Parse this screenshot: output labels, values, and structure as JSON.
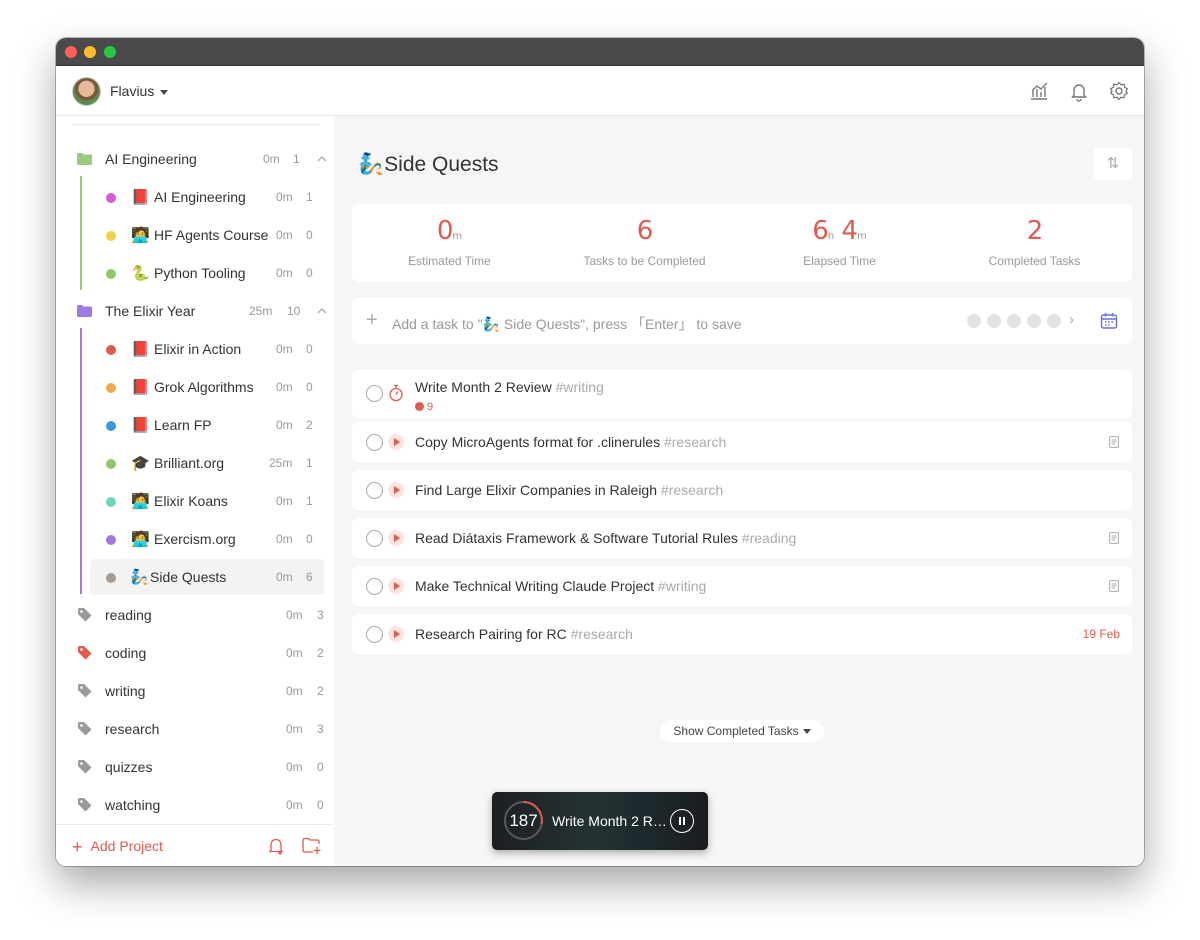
{
  "user": {
    "name": "Flavius"
  },
  "sidebar": {
    "groups": [
      {
        "label": "AI Engineering",
        "time": "0m",
        "count": "1",
        "color": "#9cc97a",
        "children": [
          {
            "emoji": "📕",
            "label": "AI Engineering",
            "time": "0m",
            "count": "1",
            "color": "#d55bd0"
          },
          {
            "emoji": "🧑‍💻",
            "label": "HF Agents Course",
            "time": "0m",
            "count": "0",
            "color": "#f0cf4a"
          },
          {
            "emoji": "🐍",
            "label": "Python Tooling",
            "time": "0m",
            "count": "0",
            "color": "#8fc76a"
          }
        ]
      },
      {
        "label": "The Elixir Year",
        "time": "25m",
        "count": "10",
        "color": "#a07ae0",
        "children": [
          {
            "emoji": "📕",
            "label": "Elixir in Action",
            "time": "0m",
            "count": "0",
            "color": "#e05a4e"
          },
          {
            "emoji": "📕",
            "label": "Grok Algorithms",
            "time": "0m",
            "count": "0",
            "color": "#f0a94a"
          },
          {
            "emoji": "📕",
            "label": "Learn FP",
            "time": "0m",
            "count": "2",
            "color": "#3a9ad9"
          },
          {
            "emoji": "🎓",
            "label": "Brilliant.org",
            "time": "25m",
            "count": "1",
            "color": "#8fc76a"
          },
          {
            "emoji": "🧑‍💻",
            "label": "Elixir Koans",
            "time": "0m",
            "count": "1",
            "color": "#6fd6c0"
          },
          {
            "emoji": "🧑‍💻",
            "label": "Exercism.org",
            "time": "0m",
            "count": "0",
            "color": "#a07ae0"
          },
          {
            "emoji": "🧞",
            "label": "Side Quests",
            "time": "0m",
            "count": "6",
            "color": "#a89a8c"
          }
        ]
      }
    ],
    "tags": [
      {
        "label": "reading",
        "time": "0m",
        "count": "3",
        "color": "#9a9a9a"
      },
      {
        "label": "coding",
        "time": "0m",
        "count": "2",
        "color": "#e05a4e"
      },
      {
        "label": "writing",
        "time": "0m",
        "count": "2",
        "color": "#9a9a9a"
      },
      {
        "label": "research",
        "time": "0m",
        "count": "3",
        "color": "#9a9a9a"
      },
      {
        "label": "quizzes",
        "time": "0m",
        "count": "0",
        "color": "#9a9a9a"
      },
      {
        "label": "watching",
        "time": "0m",
        "count": "0",
        "color": "#9a9a9a"
      }
    ],
    "add_project_label": "Add Project"
  },
  "main": {
    "project_emoji": "🧞",
    "project_title": "Side Quests",
    "sort_icon": "⇅",
    "stats": [
      {
        "value": "0",
        "unit": "m",
        "label": "Estimated Time"
      },
      {
        "value": "6",
        "unit": "",
        "label": "Tasks to be Completed"
      },
      {
        "value_h": "6",
        "value_m": "4",
        "label": "Elapsed Time"
      },
      {
        "value": "2",
        "unit": "",
        "label": "Completed Tasks"
      }
    ],
    "add_task_placeholder": "Add a task to \"🧞 Side Quests\", press 「Enter」 to save",
    "tasks": [
      {
        "title": "Write Month 2 Review",
        "tag": "#writing",
        "pomodoros": "9",
        "has_note": false,
        "due": "",
        "in_progress": true
      },
      {
        "title": "Copy MicroAgents format for .clinerules",
        "tag": "#research",
        "pomodoros": "",
        "has_note": true,
        "due": ""
      },
      {
        "title": "Find Large Elixir Companies in Raleigh",
        "tag": "#research",
        "pomodoros": "",
        "has_note": false,
        "due": ""
      },
      {
        "title": "Read Diátaxis Framework & Software Tutorial Rules",
        "tag": "#reading",
        "pomodoros": "",
        "has_note": true,
        "due": ""
      },
      {
        "title": "Make Technical Writing Claude Project",
        "tag": "#writing",
        "pomodoros": "",
        "has_note": true,
        "due": ""
      },
      {
        "title": "Research Pairing for RC",
        "tag": "#research",
        "pomodoros": "",
        "has_note": false,
        "due": "19 Feb"
      }
    ],
    "show_completed_label": "Show Completed Tasks"
  },
  "mini_timer": {
    "value": "187",
    "title": "Write Month 2 R…"
  },
  "colors": {
    "accent": "#e05a4e",
    "calendar": "#6b6fd6"
  }
}
